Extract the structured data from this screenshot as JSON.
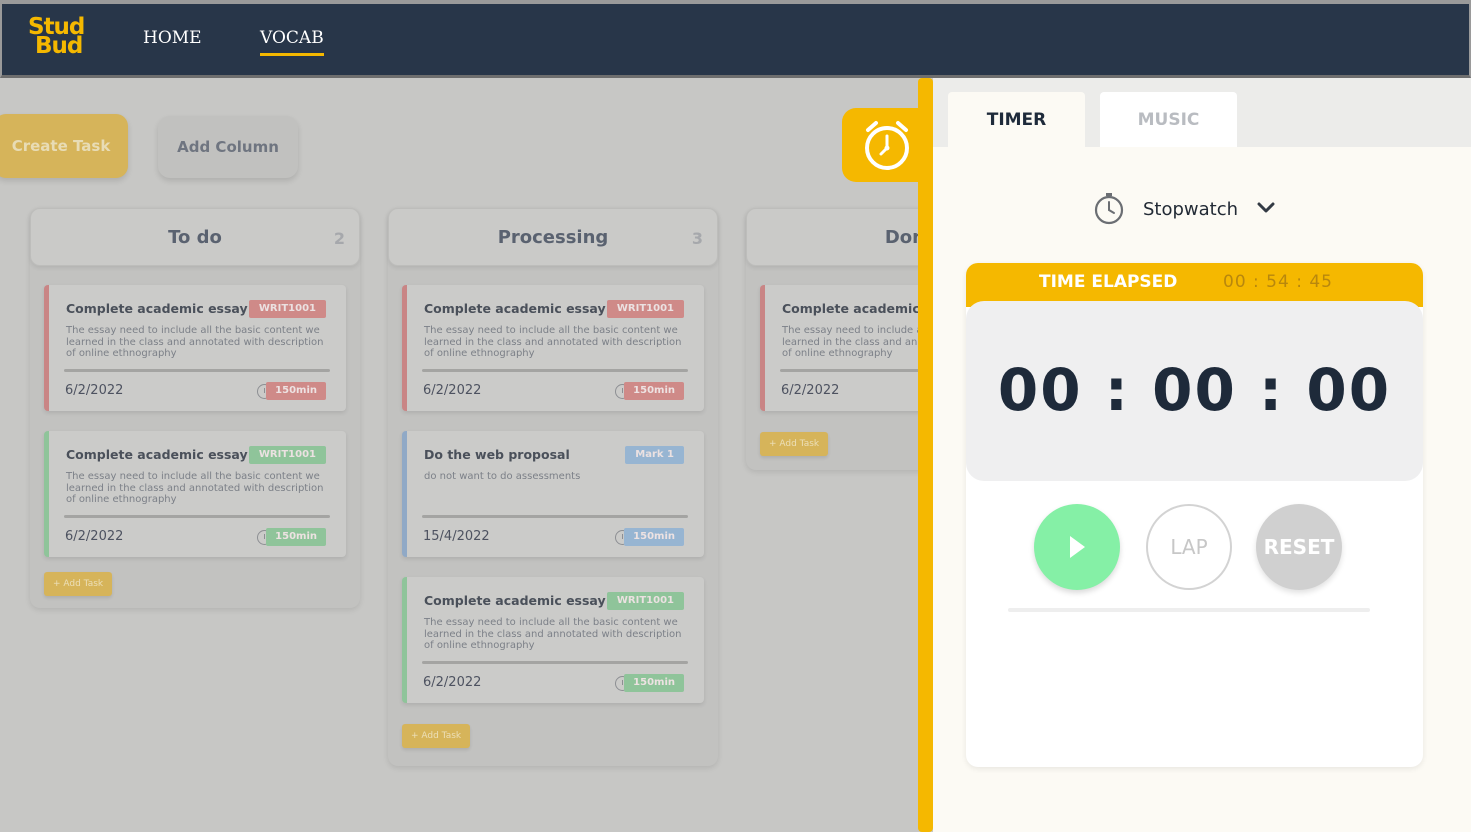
{
  "nav": {
    "logo_line1": "Stud",
    "logo_line2": "Bud",
    "home": "HOME",
    "vocab": "VOCAB"
  },
  "board": {
    "create_task": "Create Task",
    "add_column": "Add Column",
    "add_task": "+ Add Task",
    "columns": [
      {
        "title": "To do",
        "count": "2",
        "cards": [
          {
            "title": "Complete academic essay",
            "tag": "WRIT1001",
            "desc": "The essay need to include all the basic content we learned in the class and annotated with description of online ethnography",
            "date": "6/2/2022",
            "mins": "150min"
          },
          {
            "title": "Complete academic essay",
            "tag": "WRIT1001",
            "desc": "The essay need to include all the basic content we learned in the class and annotated with description of online ethnography",
            "date": "6/2/2022",
            "mins": "150min"
          }
        ]
      },
      {
        "title": "Processing",
        "count": "3",
        "cards": [
          {
            "title": "Complete academic essay",
            "tag": "WRIT1001",
            "desc": "The essay need to include all the basic content we learned in the class and annotated with description of online ethnography",
            "date": "6/2/2022",
            "mins": "150min"
          },
          {
            "title": "Do the web proposal",
            "tag": "Mark 1",
            "desc": "do not want to do assessments",
            "date": "15/4/2022",
            "mins": "150min"
          },
          {
            "title": "Complete academic essay",
            "tag": "WRIT1001",
            "desc": "The essay need to include all the basic content we learned in the class and annotated with description of online ethnography",
            "date": "6/2/2022",
            "mins": "150min"
          }
        ]
      },
      {
        "title": "Done",
        "count": "",
        "cards": [
          {
            "title": "Complete academic essay",
            "tag": "",
            "desc": "The essay need to include all the basic content we learned in the class and annotated with description of online ethnography",
            "date": "6/2/2022",
            "mins": ""
          }
        ]
      }
    ]
  },
  "panel": {
    "tab_timer": "TIMER",
    "tab_music": "MUSIC",
    "mode": "Stopwatch",
    "elapsed_label": "TIME ELAPSED",
    "elapsed_time": "00 : 54 : 45",
    "display_time": "00 : 00 : 00",
    "lap": "LAP",
    "reset": "RESET"
  },
  "icons": {
    "timer_fab": "alarm-clock-icon",
    "mode_icon": "stopwatch-icon",
    "mode_chevron": "chevron-down-icon",
    "play": "play-icon",
    "card_clock": "clock-icon"
  },
  "colors": {
    "navbar": "#283649",
    "accent": "#f5b800",
    "play": "#85f0a6",
    "red_label": "#cf8a88",
    "green_label": "#8fc49a",
    "blue_label": "#97b5d2"
  }
}
